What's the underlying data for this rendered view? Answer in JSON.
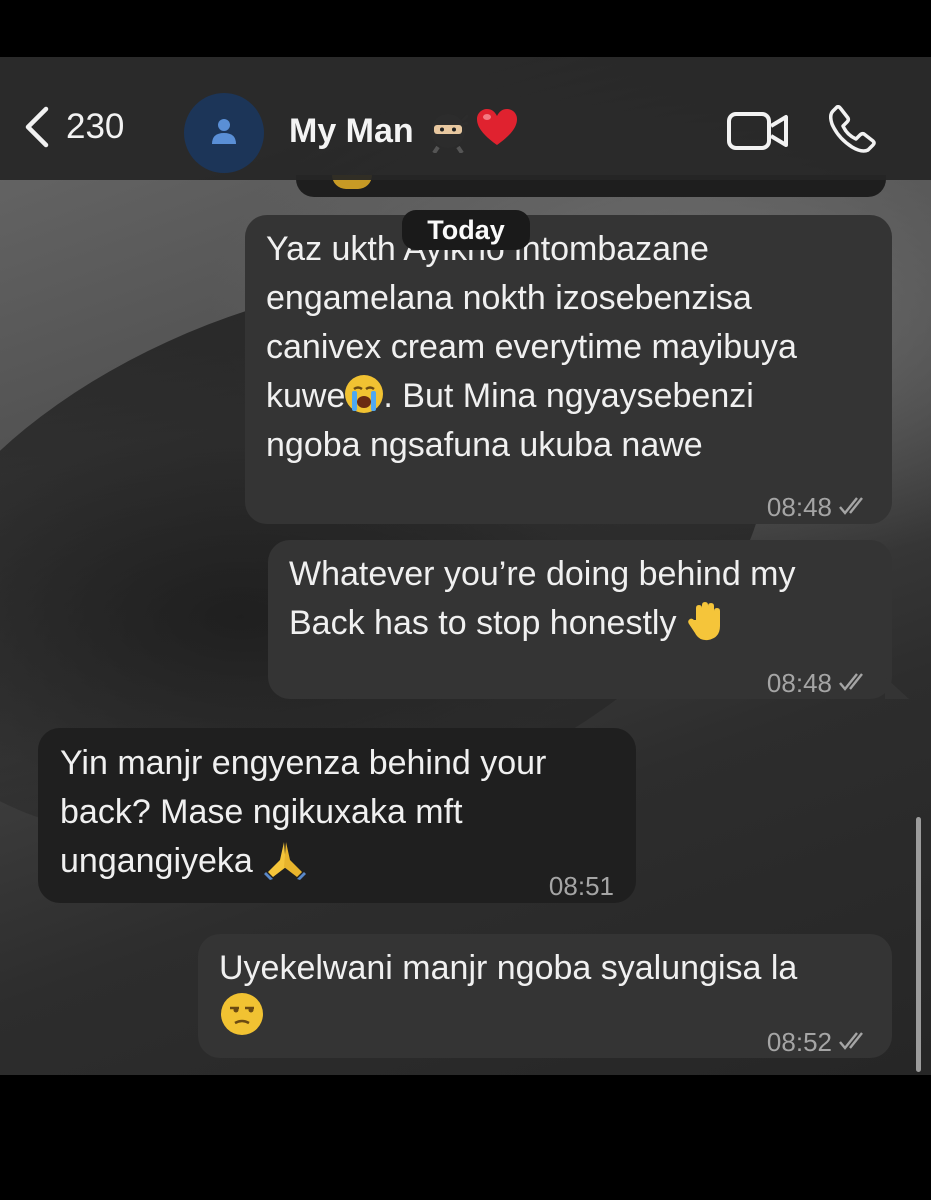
{
  "header": {
    "back_count": "230",
    "contact_name": "My Man",
    "back_icon": "chevron-left-icon",
    "avatar_icon": "person-icon",
    "video_icon": "video-camera-icon",
    "call_icon": "phone-icon"
  },
  "date_divider": "Today",
  "messages": [
    {
      "direction": "outgoing",
      "lines": [
        "Yaz ukth Ayikho intombazane",
        "engamelana nokth izosebenzisa",
        "canivex cream everytime mayibuya",
        "kuwe",
        ". But Mina ngyaysebenzi",
        "ngoba ngsafuna ukuba nawe"
      ],
      "emoji": "loudly-crying-face",
      "time": "08:48",
      "status": "read"
    },
    {
      "direction": "outgoing",
      "lines": [
        "Whatever you’re doing behind my",
        "Back has to stop honestly"
      ],
      "emoji": "raised-hand",
      "time": "08:48",
      "status": "read"
    },
    {
      "direction": "incoming",
      "lines": [
        "Yin manjr engyenza behind your",
        "back? Mase ngikuxaka mft",
        "ungangiyeka"
      ],
      "emoji": "folded-hands",
      "time": "08:51"
    },
    {
      "direction": "outgoing",
      "lines": [
        "Uyekelwani manjr ngoba syalungisa la"
      ],
      "emoji": "unamused-face",
      "time": "08:52",
      "status": "read"
    }
  ],
  "colors": {
    "outgoing_bubble": "#343434",
    "incoming_bubble": "#1f1f1f",
    "avatar_bg": "#1c3558",
    "avatar_fg": "#5a8fd6",
    "heart": "#e0222f"
  }
}
